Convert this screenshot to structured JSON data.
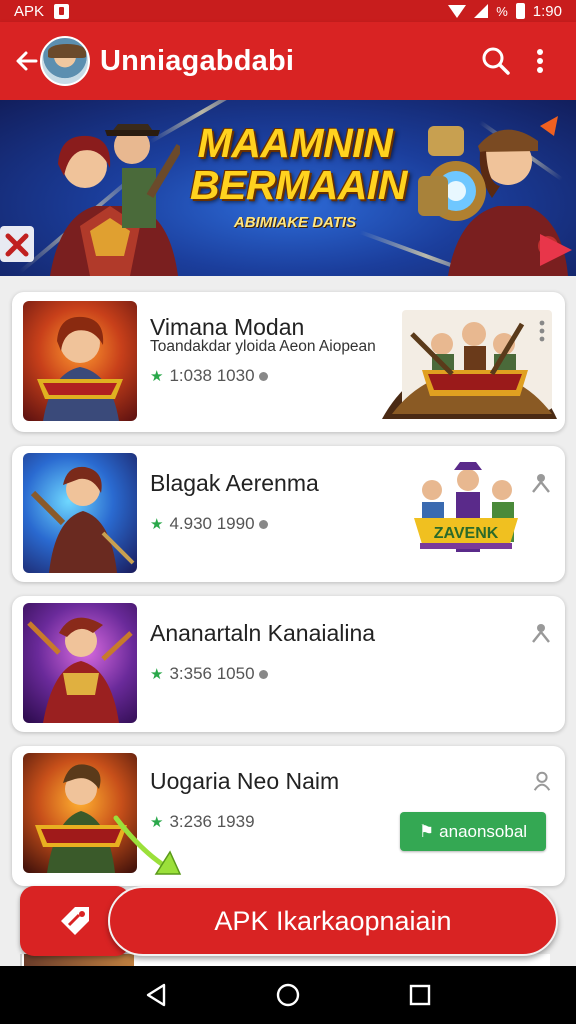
{
  "status_bar": {
    "carrier": "APK",
    "percent": "%",
    "time": "1:90"
  },
  "app_bar": {
    "title": "Unniagabdabi",
    "icons": [
      "back-arrow-icon",
      "avatar",
      "search-icon",
      "more-vert-icon"
    ]
  },
  "banner": {
    "title_line1": "MAAMNIN",
    "title_line2": "BERMAAIN",
    "subtitle": "ABIMIAKE DATIS"
  },
  "apps": [
    {
      "title": "Vimana Modan",
      "subtitle": "Toandakdar yloida Aeon Aiopean",
      "rating": "1:038 1030",
      "menu_icon": "more-vert-icon"
    },
    {
      "title": "Blagak Aerenma",
      "rating": "4.930 1990",
      "menu_icon": "person-icon",
      "art_text": "ZAVENK"
    },
    {
      "title": "Ananartaln Kanaialina",
      "rating": "3:356 1050",
      "menu_icon": "person-icon"
    },
    {
      "title": "Uogaria Neo Naim",
      "rating": "3:236 1939",
      "menu_icon": "person-outline-icon",
      "install_label": "anaonsobal"
    }
  ],
  "cta": {
    "label": "APK Ikarkaopnaiain",
    "icon": "tag-icon"
  },
  "colors": {
    "primary_red": "#d92323",
    "status_red": "#c81d1d",
    "install_green": "#34a853",
    "banner_title_yellow": "#ffd21f"
  },
  "nav_bar": [
    "back-triangle-icon",
    "home-circle-icon",
    "recents-square-icon"
  ]
}
